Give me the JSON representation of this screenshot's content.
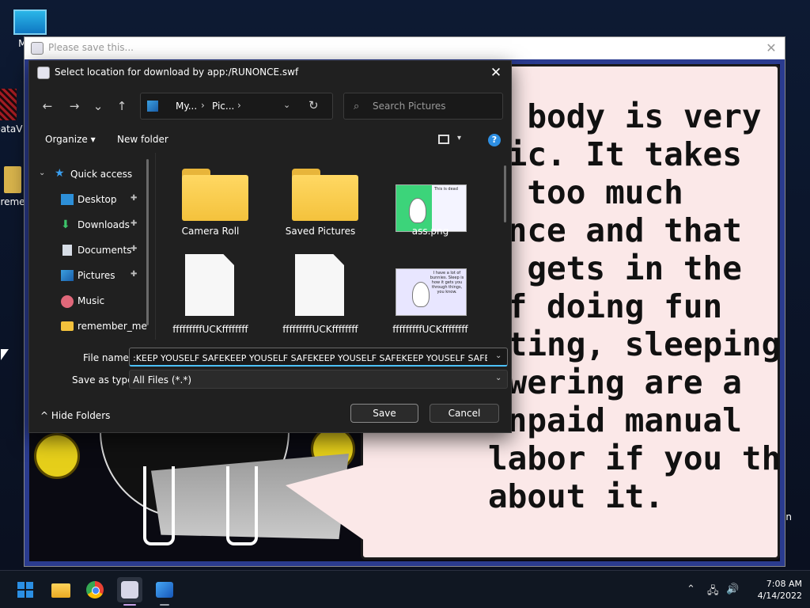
{
  "desktop": {
    "icons": [
      {
        "label": "My C"
      },
      {
        "label": "DataV"
      },
      {
        "label": "reme"
      }
    ],
    "right_edge_text": "in"
  },
  "flash_window": {
    "title": "Please save this...",
    "close": "✕",
    "bubble_text": "a body is very\ntic. It takes\n/ too much\nance and that\nf gets in the\nof doing fun\nating, sleeping,\nowering are a\nunpaid manual\nlabor if you think\nabout it."
  },
  "dialog": {
    "title": "Select location for download by app:/RUNONCE.swf",
    "close": "✕",
    "nav": {
      "back": "←",
      "forward": "→",
      "recent": "⌄",
      "up": "↑"
    },
    "breadcrumb": [
      {
        "label": "My..."
      },
      {
        "label": "Pic..."
      }
    ],
    "breadcrumb_sep": "›",
    "address_dropdown": "⌄",
    "refresh": "↻",
    "search": {
      "placeholder": "Search Pictures",
      "icon": "⌕"
    },
    "commands": {
      "organize": "Organize ▾",
      "new_folder": "New folder",
      "view_caret": "▾",
      "help": "?"
    },
    "nav_pane": {
      "expand": "⌄",
      "quick_access": "Quick access",
      "items": [
        {
          "label": "Desktop",
          "pinned": true,
          "icon": "desktop-icon"
        },
        {
          "label": "Downloads",
          "pinned": true,
          "icon": "download-icon"
        },
        {
          "label": "Documents",
          "pinned": true,
          "icon": "documents-icon"
        },
        {
          "label": "Pictures",
          "pinned": true,
          "icon": "pictures-icon"
        },
        {
          "label": "Music",
          "pinned": false,
          "icon": "music-icon"
        },
        {
          "label": "remember_me",
          "pinned": false,
          "icon": "folder-icon"
        }
      ],
      "pin_glyph": "📌"
    },
    "files": [
      {
        "label": "Camera Roll",
        "kind": "folder"
      },
      {
        "label": "Saved Pictures",
        "kind": "folder"
      },
      {
        "label": "ass.png",
        "kind": "image"
      },
      {
        "label": "fffffffffUCKffffffff",
        "kind": "document"
      },
      {
        "label": "fffffffffUCKffffffff",
        "kind": "document"
      },
      {
        "label": "fffffffffUCKffffffff",
        "kind": "image"
      }
    ],
    "thumb_captions": [
      "This is dead",
      "I have a lot of bunnies. Sleep is how it gets you through things, you know."
    ],
    "file_name": {
      "label": "File name:",
      "value": ":KEEP YOUSELF SAFEKEEP YOUSELF SAFEKEEP YOUSELF SAFEKEEP YOUSELF SAFE.png",
      "caret": "⌄"
    },
    "save_as_type": {
      "label": "Save as type:",
      "value": "All Files (*.*)",
      "caret": "⌄"
    },
    "hide_folders": "^ Hide Folders",
    "save": "Save",
    "cancel": "Cancel"
  },
  "taskbar": {
    "apps": [
      {
        "name": "start",
        "active": false
      },
      {
        "name": "file-explorer",
        "active": false
      },
      {
        "name": "chrome",
        "active": false
      },
      {
        "name": "flash-player",
        "active": true
      },
      {
        "name": "photos",
        "active": false
      }
    ],
    "tray": {
      "chevron": "⌃",
      "network": "🖧",
      "volume": "🔊"
    },
    "clock": {
      "time": "7:08 AM",
      "date": "4/14/2022"
    }
  },
  "colors": {
    "accent": "#4cc2ff",
    "dialog_bg": "#202020",
    "bubble_bg": "#fbe8e8",
    "folder_yellow": "#f4c23c"
  }
}
